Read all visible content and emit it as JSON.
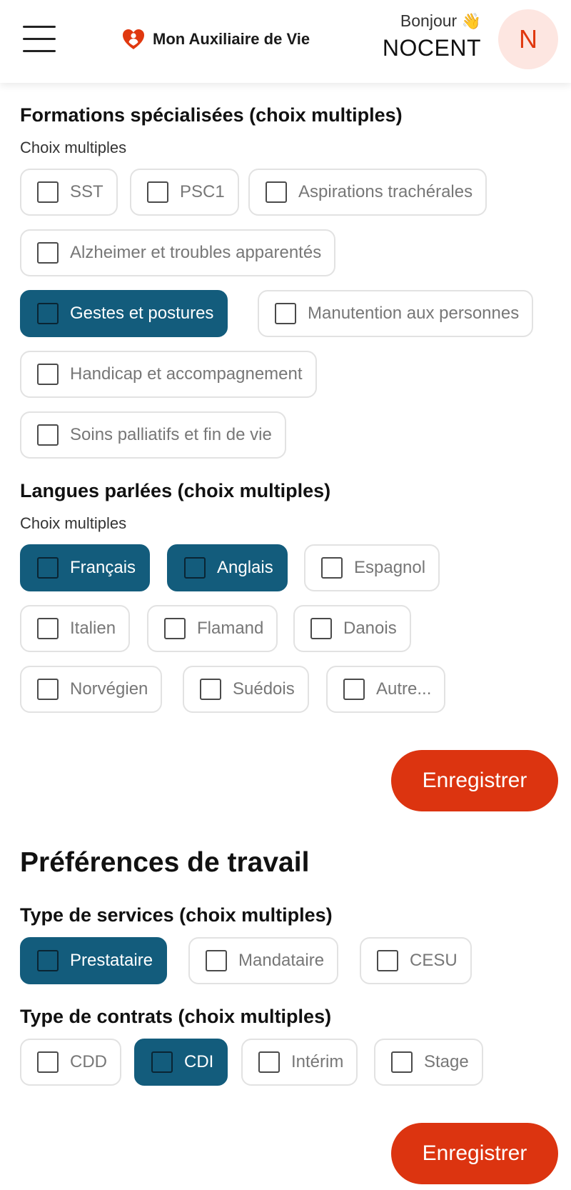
{
  "header": {
    "logo_text": "Mon Auxiliaire de Vie",
    "greeting": "Bonjour",
    "wave_emoji": "👋",
    "username": "NOCENT",
    "avatar_initial": "N",
    "colors": {
      "accent": "#dc3410",
      "avatar_bg": "#fde6e1",
      "selected_chip": "#135c7c"
    }
  },
  "formations": {
    "title": "Formations spécialisées (choix multiples)",
    "subtitle": "Choix multiples",
    "options": [
      {
        "label": "SST",
        "selected": false
      },
      {
        "label": "PSC1",
        "selected": false
      },
      {
        "label": "Aspirations trachérales",
        "selected": false
      },
      {
        "label": "Alzheimer et troubles apparentés",
        "selected": false
      },
      {
        "label": "Gestes et postures",
        "selected": true
      },
      {
        "label": "Manutention aux personnes",
        "selected": false
      },
      {
        "label": "Handicap et accompagnement",
        "selected": false
      },
      {
        "label": "Soins palliatifs et fin de vie",
        "selected": false
      }
    ]
  },
  "langues": {
    "title": "Langues parlées (choix multiples)",
    "subtitle": "Choix multiples",
    "options": [
      {
        "label": "Français",
        "selected": true
      },
      {
        "label": "Anglais",
        "selected": true
      },
      {
        "label": "Espagnol",
        "selected": false
      },
      {
        "label": "Italien",
        "selected": false
      },
      {
        "label": "Flamand",
        "selected": false
      },
      {
        "label": "Danois",
        "selected": false
      },
      {
        "label": "Norvégien",
        "selected": false
      },
      {
        "label": "Suédois",
        "selected": false
      },
      {
        "label": "Autre...",
        "selected": false
      }
    ]
  },
  "save_label_1": "Enregistrer",
  "preferences": {
    "title": "Préférences de travail",
    "services": {
      "title": "Type de services (choix multiples)",
      "options": [
        {
          "label": "Prestataire",
          "selected": true
        },
        {
          "label": "Mandataire",
          "selected": false
        },
        {
          "label": "CESU",
          "selected": false
        }
      ]
    },
    "contrats": {
      "title": "Type de contrats (choix multiples)",
      "options": [
        {
          "label": "CDD",
          "selected": false
        },
        {
          "label": "CDI",
          "selected": true
        },
        {
          "label": "Intérim",
          "selected": false
        },
        {
          "label": "Stage",
          "selected": false
        }
      ]
    }
  },
  "save_label_2": "Enregistrer"
}
